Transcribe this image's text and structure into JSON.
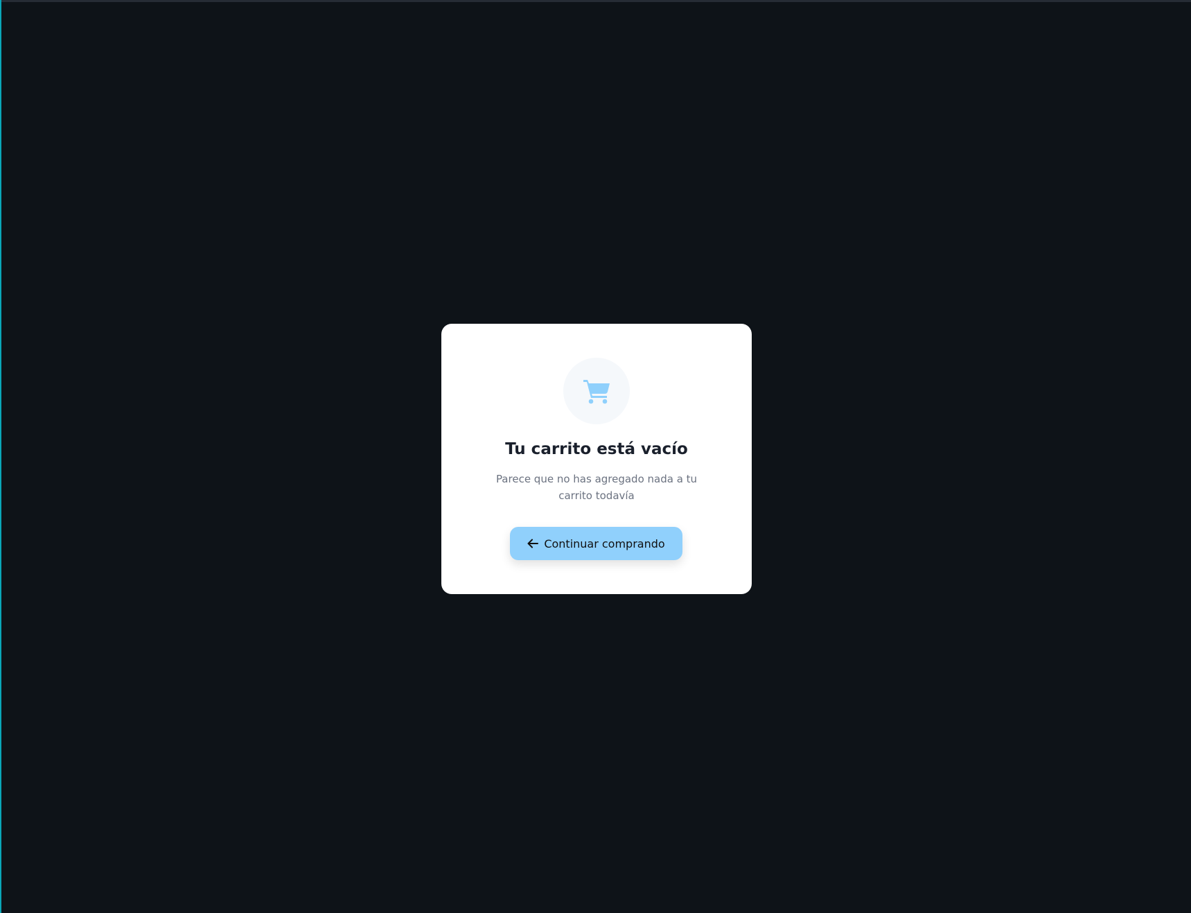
{
  "colors": {
    "background": "#0e1318",
    "accent": "#90d0fc",
    "icon": "#8fd0fc"
  },
  "empty_cart": {
    "icon": "shopping-cart-icon",
    "title": "Tu carrito está vacío",
    "message": "Parece que no has agregado nada a tu carrito todavía",
    "button": {
      "icon": "arrow-left-icon",
      "label": "Continuar comprando"
    }
  }
}
